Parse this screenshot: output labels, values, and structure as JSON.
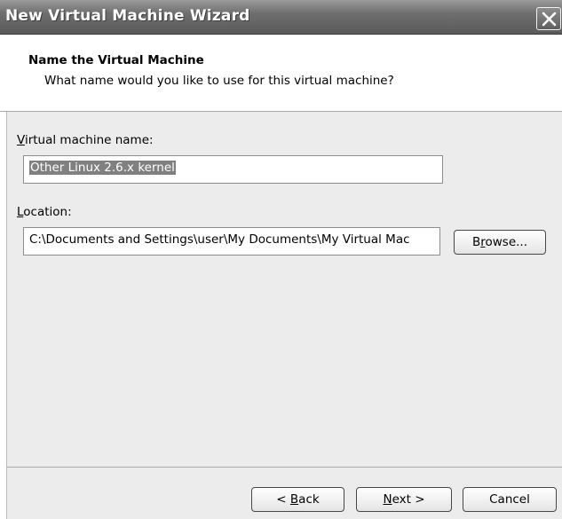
{
  "window": {
    "title": "New Virtual Machine Wizard"
  },
  "header": {
    "title": "Name the Virtual Machine",
    "subtitle": "What name would you like to use for this virtual machine?"
  },
  "form": {
    "name_label_key": "V",
    "name_label_rest": "irtual machine name:",
    "name_value": "Other Linux 2.6.x kernel",
    "location_label_key": "L",
    "location_label_rest": "ocation:",
    "location_value": "C:\\Documents and Settings\\user\\My Documents\\My Virtual Mac",
    "browse_label_pre": "B",
    "browse_label_key": "r",
    "browse_label_post": "owse..."
  },
  "footer": {
    "back_pre": "< ",
    "back_key": "B",
    "back_post": "ack",
    "next_key": "N",
    "next_post": "ext >",
    "cancel_label": "Cancel"
  }
}
